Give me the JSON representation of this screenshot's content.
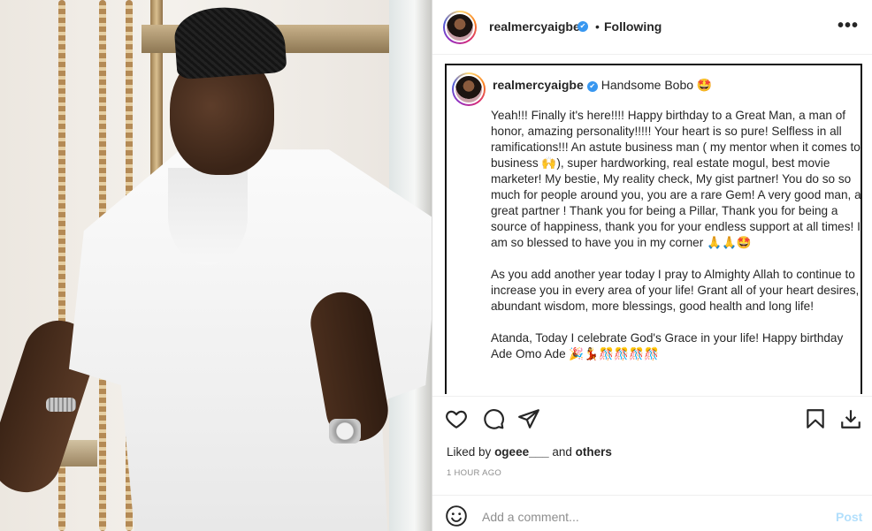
{
  "post": {
    "header": {
      "username": "realmercyaigbe",
      "separator": "•",
      "follow_status": "Following",
      "more_label": "•••"
    },
    "caption": {
      "username": "realmercyaigbe",
      "headline": "Handsome Bobo 🤩",
      "paragraphs": [
        "Yeah!!! Finally it's here!!!! Happy birthday to a Great Man, a man of honor, amazing personality!!!!! Your heart is so pure! Selfless in all ramifications!!! An astute business man ( my mentor when it comes to business 🙌), super hardworking, real estate mogul, best movie marketer! My bestie, My reality check, My gist partner! You do so so much for people around you, you are a rare Gem! A very good man, a great partner ! Thank you for being a Pillar, Thank you for being a source of happiness, thank you for your endless support at all times! I am so blessed to have you in my corner 🙏🙏🤩",
        "As you add another year today I pray to Almighty Allah to continue to increase you in every area of your life! Grant all of your heart desires, abundant wisdom, more blessings, good health and long life!",
        "Atanda, Today I celebrate God's Grace in your life! Happy birthday Ade Omo Ade 🎉💃🎊🎊🎊🎊"
      ]
    },
    "likes": {
      "prefix": "Liked by",
      "user": "ogeee___",
      "and": "and",
      "others": "others"
    },
    "timestamp": "1 HOUR AGO",
    "comment": {
      "placeholder": "Add a comment...",
      "post_label": "Post"
    },
    "icons": [
      "heart-icon",
      "comment-icon",
      "share-icon",
      "bookmark-icon",
      "download-icon",
      "emoji-icon",
      "verified-badge-icon"
    ],
    "colors": {
      "verified": "#3897f0",
      "post_button": "#b2dffc",
      "muted_text": "#8e8e8e"
    }
  }
}
